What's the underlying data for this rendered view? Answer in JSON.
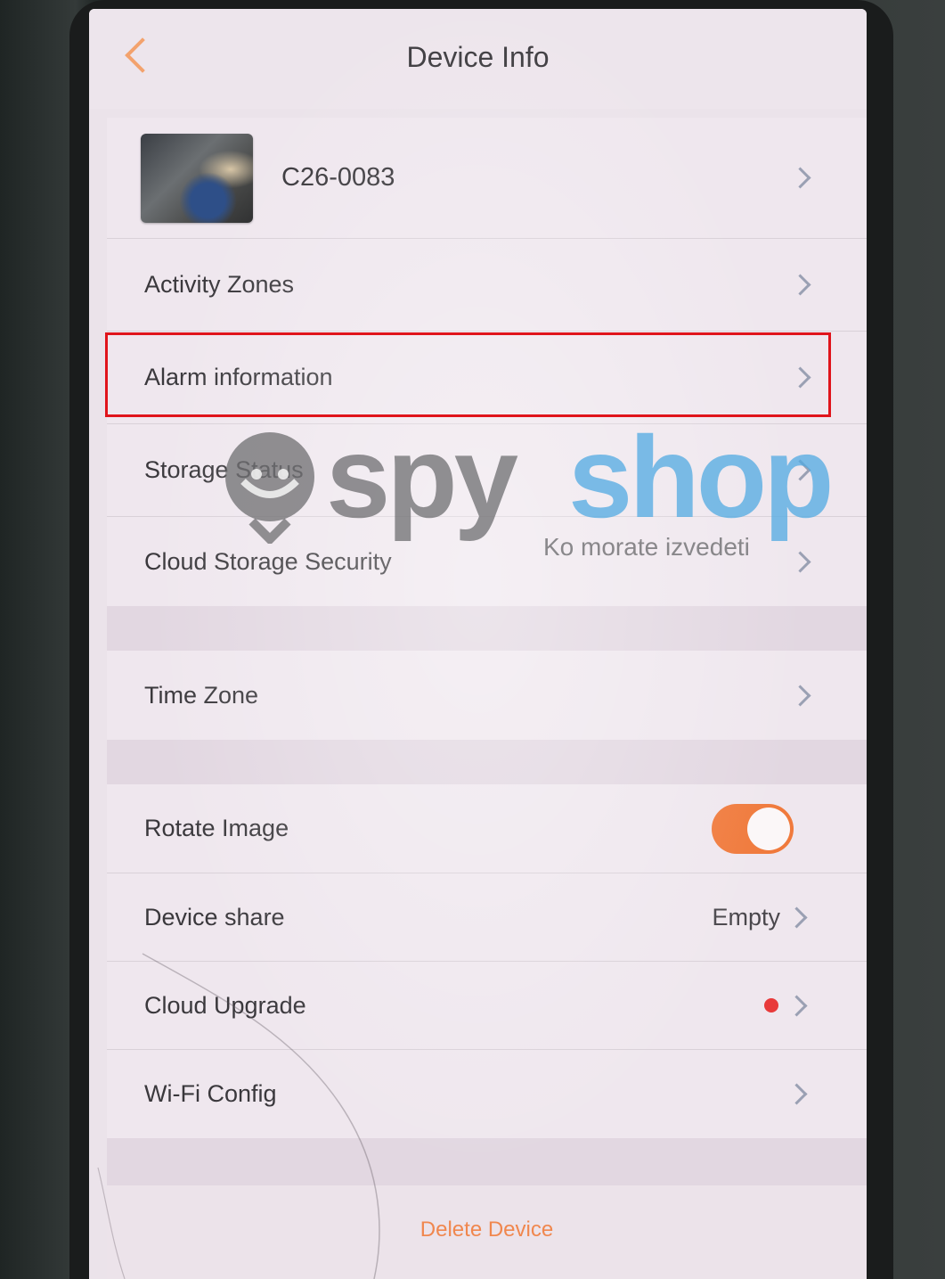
{
  "header": {
    "title": "Device Info"
  },
  "device": {
    "name": "C26-0083"
  },
  "section1": {
    "items": [
      {
        "label": "Activity Zones"
      },
      {
        "label": "Alarm information"
      },
      {
        "label": "Storage Status"
      },
      {
        "label": "Cloud Storage Security"
      }
    ]
  },
  "section2": {
    "items": [
      {
        "label": "Time Zone"
      }
    ]
  },
  "section3": {
    "rotate_image": {
      "label": "Rotate Image",
      "enabled": true
    },
    "device_share": {
      "label": "Device share",
      "value": "Empty"
    },
    "cloud_upgrade": {
      "label": "Cloud Upgrade"
    },
    "wifi_config": {
      "label": "Wi-Fi Config"
    }
  },
  "actions": {
    "delete_label": "Delete Device"
  },
  "watermark": {
    "brand_left": "spy",
    "brand_right": "shop",
    "tagline": "Ko morate izvedeti"
  },
  "colors": {
    "accent": "#f07a3c",
    "highlight": "#e0141b",
    "notification_dot": "#e83a3a"
  }
}
